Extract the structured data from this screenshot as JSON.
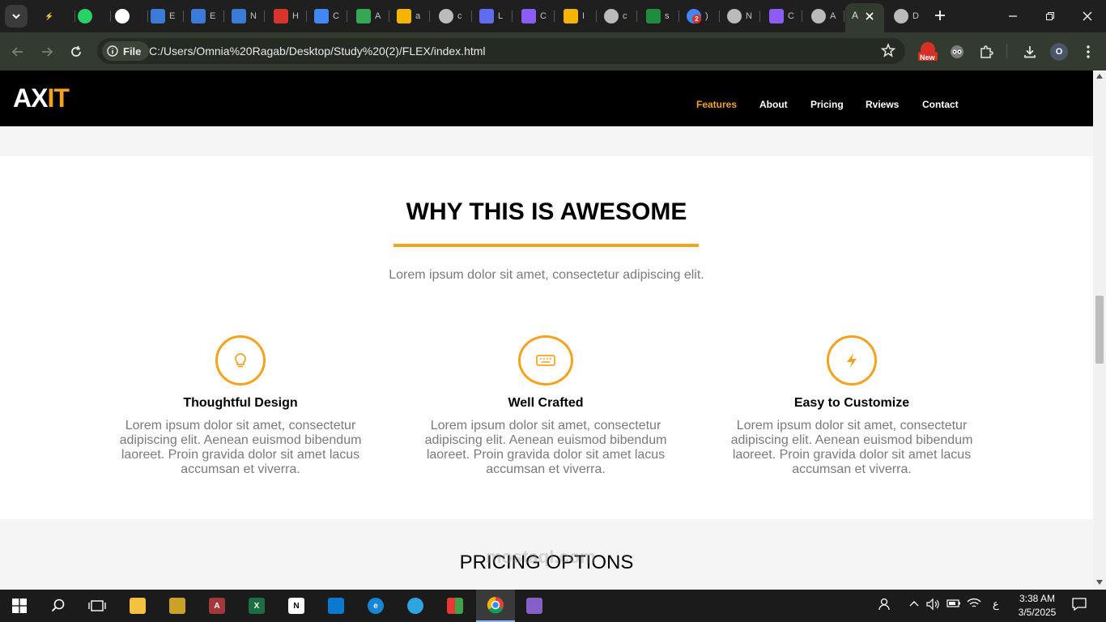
{
  "browser": {
    "tabs": [
      {
        "icon": "brand-icon",
        "color": "#f7a21c",
        "label": ""
      },
      {
        "icon": "whatsapp-icon",
        "color": "#25d366",
        "label": ""
      },
      {
        "icon": "openai-icon",
        "color": "#ffffff",
        "label": ""
      },
      {
        "icon": "notion-n-icon",
        "color": "#3b7bd8",
        "label": "E"
      },
      {
        "icon": "notion-n-icon",
        "color": "#3b7bd8",
        "label": "E"
      },
      {
        "icon": "notion-n-icon",
        "color": "#3b7bd8",
        "label": "N"
      },
      {
        "icon": "hsu-icon",
        "color": "#d9342b",
        "label": "H"
      },
      {
        "icon": "chart-icon",
        "color": "#4285f4",
        "label": "C"
      },
      {
        "icon": "drive-icon",
        "color": "#34a853",
        "label": "A"
      },
      {
        "icon": "number-five-icon",
        "color": "#f4b400",
        "label": "a"
      },
      {
        "icon": "globe-icon",
        "color": "#bbbbbb",
        "label": "c"
      },
      {
        "icon": "video-icon",
        "color": "#5f6bf1",
        "label": "L"
      },
      {
        "icon": "p-icon",
        "color": "#8b5cf6",
        "label": "C"
      },
      {
        "icon": "slides-icon",
        "color": "#f4b400",
        "label": "I"
      },
      {
        "icon": "globe-icon",
        "color": "#bbbbbb",
        "label": "c"
      },
      {
        "icon": "classroom-icon",
        "color": "#1e8e3e",
        "label": "s"
      },
      {
        "icon": "badge-icon",
        "color": "#4285f4",
        "label": ")"
      },
      {
        "icon": "chrome-icon",
        "color": "#bbbbbb",
        "label": "N"
      },
      {
        "icon": "p-icon",
        "color": "#8b5cf6",
        "label": "C"
      },
      {
        "icon": "globe-icon",
        "color": "#bbbbbb",
        "label": "A"
      },
      {
        "icon": "active-tab",
        "color": "#ffffff",
        "label": "A"
      },
      {
        "icon": "globe-icon",
        "color": "#bbbbbb",
        "label": "D"
      }
    ],
    "chip_label": "File",
    "url": "C:/Users/Omnia%20Ragab/Desktop/Study%20(2)/FLEX/index.html",
    "badge_text": "New",
    "profile_initial": "O",
    "badge_count": "2"
  },
  "site": {
    "logo_a": "AX",
    "logo_b": "IT",
    "nav": [
      "Features",
      "About",
      "Pricing",
      "Rviews",
      "Contact"
    ],
    "accent": "#f7a21c",
    "features_title": "WHY THIS IS AWESOME",
    "features_lead": "Lorem ipsum dolor sit amet, consectetur adipiscing elit.",
    "features": [
      {
        "icon": "lightbulb-icon",
        "title": "Thoughtful Design",
        "text": "Lorem ipsum dolor sit amet, consectetur adipiscing elit. Aenean euismod bibendum laoreet. Proin gravida dolor sit amet lacus accumsan et viverra."
      },
      {
        "icon": "keyboard-icon",
        "title": "Well Crafted",
        "text": "Lorem ipsum dolor sit amet, consectetur adipiscing elit. Aenean euismod bibendum laoreet. Proin gravida dolor sit amet lacus accumsan et viverra."
      },
      {
        "icon": "bolt-icon",
        "title": "Easy to Customize",
        "text": "Lorem ipsum dolor sit amet, consectetur adipiscing elit. Aenean euismod bibendum laoreet. Proin gravida dolor sit amet lacus accumsan et viverra."
      }
    ],
    "pricing_title": "PRICING OPTIONS",
    "watermark": "mostaql.com"
  },
  "taskbar": {
    "time": "3:38 AM",
    "date": "3/5/2025",
    "lang": "ع"
  }
}
